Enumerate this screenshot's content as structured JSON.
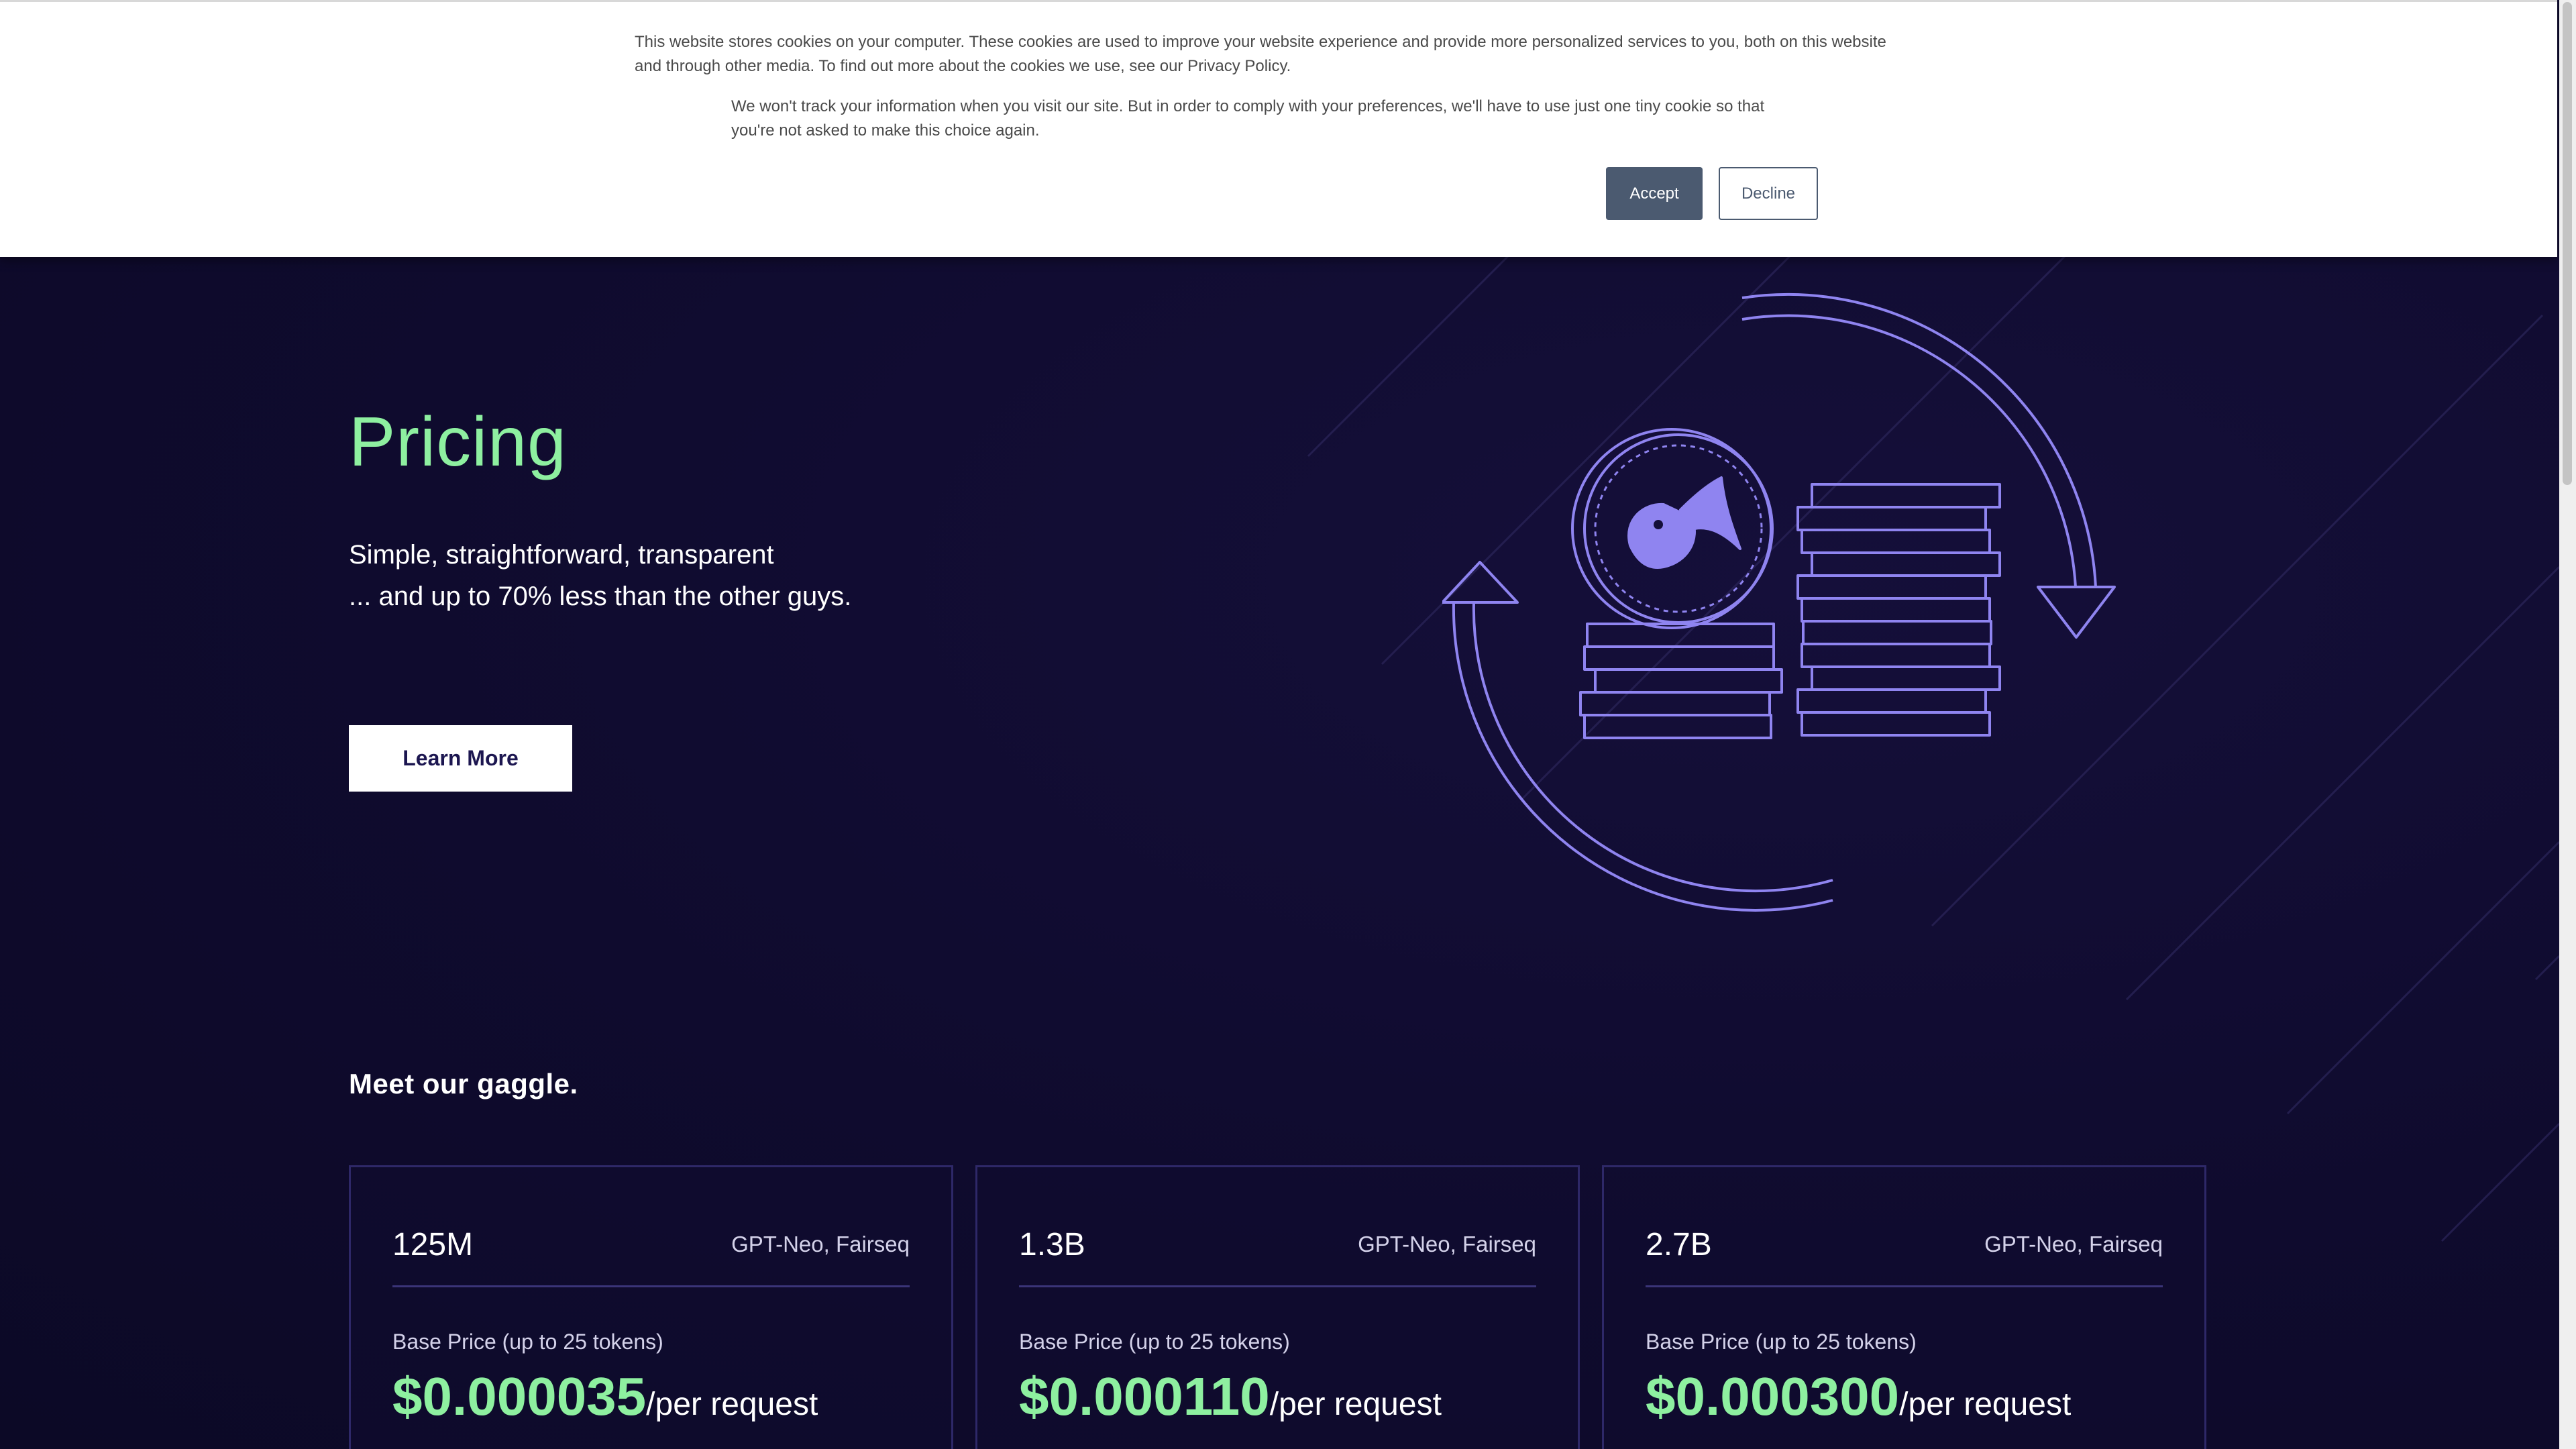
{
  "cookie_banner": {
    "text_primary": "This website stores cookies on your computer. These cookies are used to improve your website experience and provide more personalized services to you, both on this website and through other media. To find out more about the cookies we use, see our Privacy Policy.",
    "text_secondary": "We won't track your information when you visit our site. But in order to comply with your preferences, we'll have to use just one tiny cookie so that you're not asked to make this choice again.",
    "accept_label": "Accept",
    "decline_label": "Decline"
  },
  "hero": {
    "title": "Pricing",
    "subtitle_line1": "Simple, straightforward, transparent",
    "subtitle_line2": "... and up to 70% less than the other guys.",
    "cta_label": "Learn More"
  },
  "gaggle": {
    "title": "Meet our gaggle.",
    "cards": [
      {
        "size": "125M",
        "models": "GPT-Neo, Fairseq",
        "base_label": "Base Price (up to 25 tokens)",
        "price": "$0.000035",
        "unit": "/per request"
      },
      {
        "size": "1.3B",
        "models": "GPT-Neo, Fairseq",
        "base_label": "Base Price (up to 25 tokens)",
        "price": "$0.000110",
        "unit": "/per request"
      },
      {
        "size": "2.7B",
        "models": "GPT-Neo, Fairseq",
        "base_label": "Base Price (up to 25 tokens)",
        "price": "$0.000300",
        "unit": "/per request"
      }
    ]
  },
  "colors": {
    "background": "#0f0b2e",
    "accent_green": "#8ef0a0",
    "illustration_purple": "#8f84f0",
    "accept_button": "#4b5a70"
  },
  "icons": [
    "goose-logo-icon",
    "coin-stack-icon",
    "cycle-arrows-icon"
  ]
}
